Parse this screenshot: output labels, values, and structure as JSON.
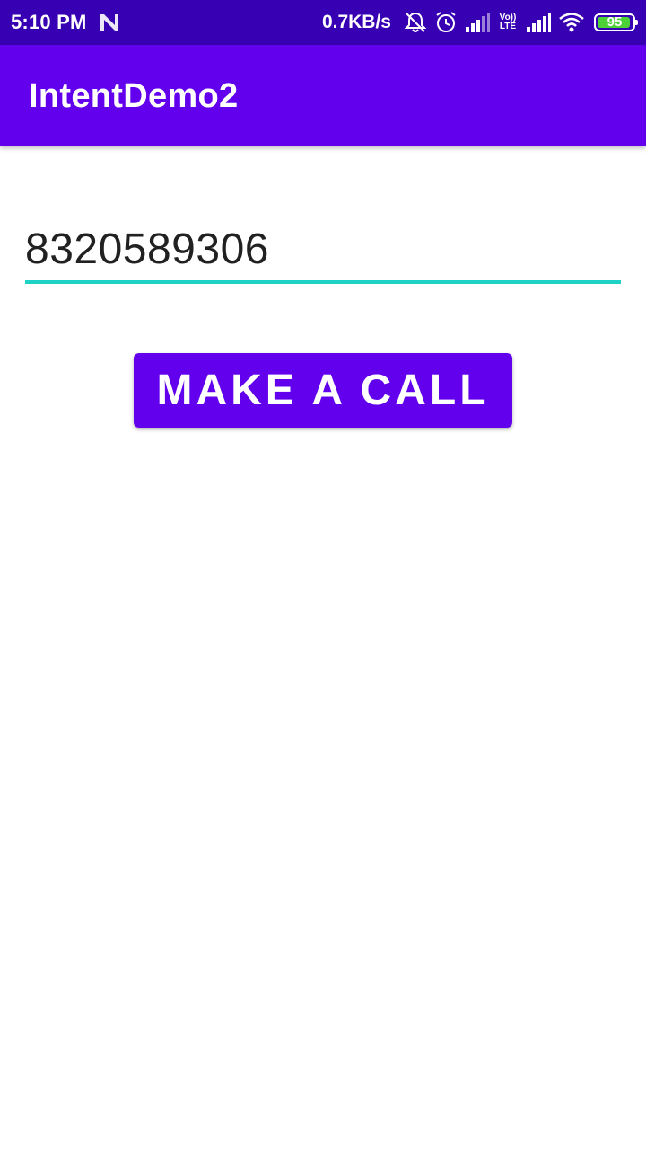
{
  "status_bar": {
    "time": "5:10 PM",
    "net_speed": "0.7KB/s",
    "volte_top": "Vo))",
    "volte_bottom": "LTE",
    "battery": "95",
    "battery_level": 0.95,
    "icons": [
      "n-notification-icon",
      "mute-bell-icon",
      "alarm-icon",
      "signal-bars-icon",
      "volte-icon",
      "signal-bars-icon",
      "wifi-icon",
      "battery-icon"
    ]
  },
  "app_bar": {
    "title": "IntentDemo2"
  },
  "phone_input": {
    "value": "8320589306"
  },
  "call_button": {
    "label": "MAKE A CALL"
  },
  "colors": {
    "status_bar": "#3700b3",
    "primary": "#6200ee",
    "accent_underline": "#1ed2c6",
    "battery_fill": "#4cd137"
  }
}
